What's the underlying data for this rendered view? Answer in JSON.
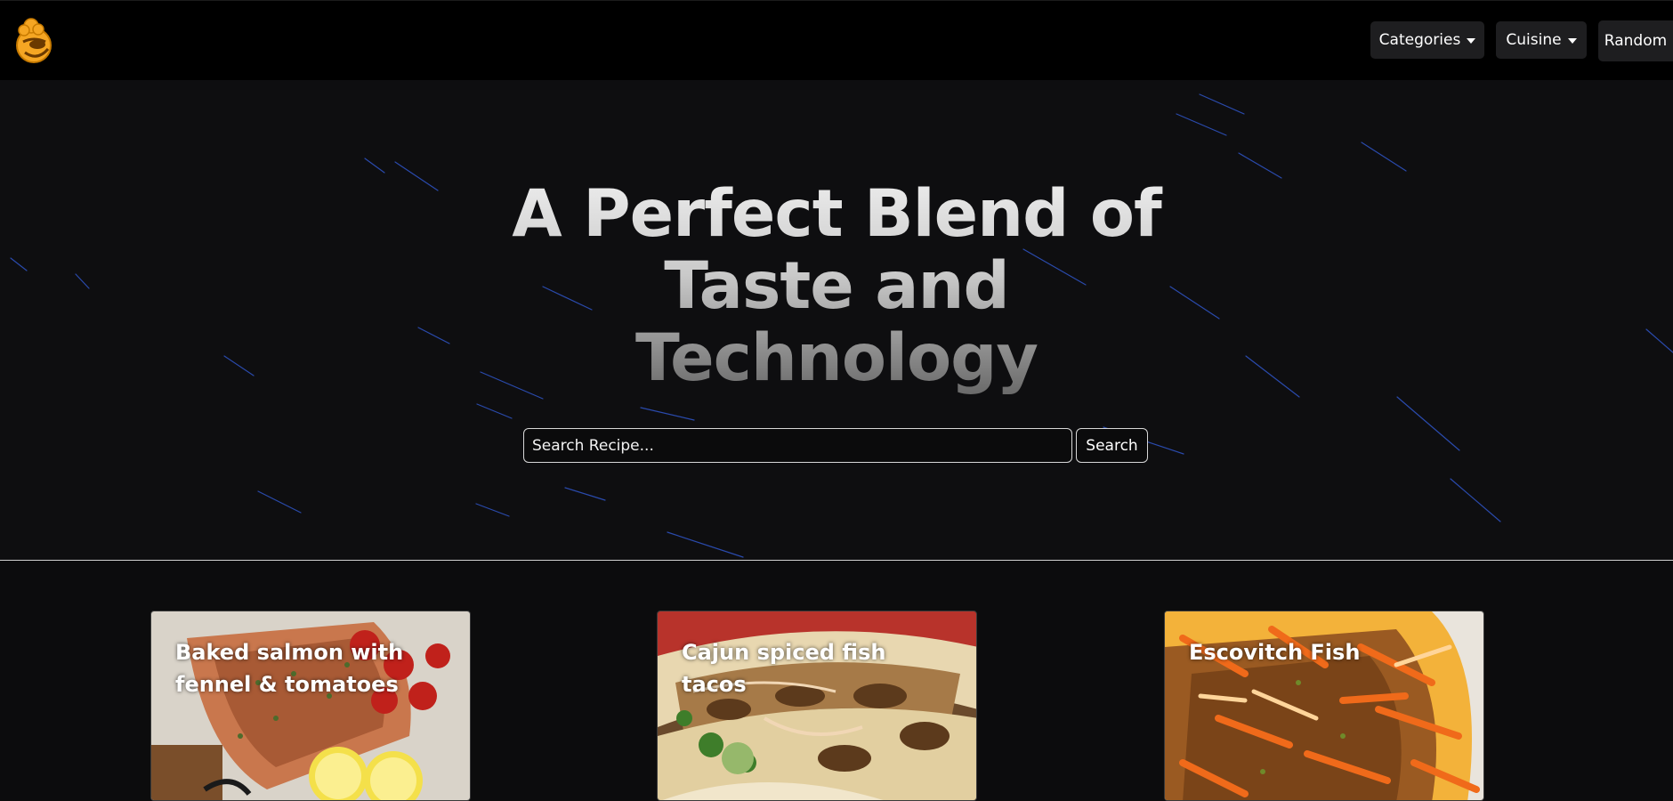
{
  "navbar": {
    "logo_icon": "chef-hat-logo-icon",
    "categories_label": "Categories",
    "cuisine_label": "Cuisine",
    "random_label": "Random",
    "accent_color": "#f5a623"
  },
  "hero": {
    "title": "A Perfect Blend of Taste and Technology",
    "search_placeholder": "Search Recipe...",
    "search_value": "",
    "search_button_label": "Search"
  },
  "cards": [
    {
      "title": "Baked salmon with fennel & tomatoes"
    },
    {
      "title": "Cajun spiced fish tacos"
    },
    {
      "title": "Escovitch Fish"
    }
  ]
}
